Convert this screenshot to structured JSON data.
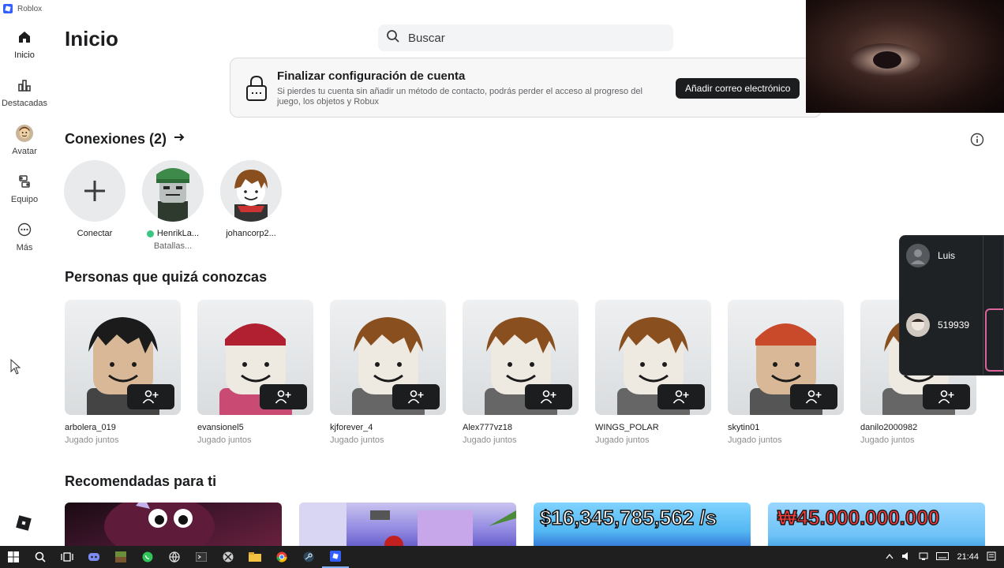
{
  "window": {
    "title": "Roblox"
  },
  "sidebar": {
    "items": [
      {
        "label": "Inicio",
        "icon": "home-icon"
      },
      {
        "label": "Destacadas",
        "icon": "charts-icon"
      },
      {
        "label": "Avatar",
        "icon": "avatar-icon"
      },
      {
        "label": "Equipo",
        "icon": "party-icon"
      },
      {
        "label": "Más",
        "icon": "more-icon"
      }
    ]
  },
  "header": {
    "title": "Inicio",
    "search_placeholder": "Buscar"
  },
  "banner": {
    "title": "Finalizar configuración de cuenta",
    "description": "Si pierdes tu cuenta sin añadir un método de contacto, podrás perder el acceso al progreso del juego, los objetos y Robux",
    "button": "Añadir correo electrónico"
  },
  "connections": {
    "title": "Conexiones (2)",
    "items": [
      {
        "name": "Conectar",
        "sub": ""
      },
      {
        "name": "HenrikLa...",
        "sub": "Batallas...",
        "online": true
      },
      {
        "name": "johancorp2...",
        "sub": ""
      }
    ]
  },
  "people": {
    "title": "Personas que quizá conozcas",
    "items": [
      {
        "name": "arbolera_019",
        "sub": "Jugado juntos"
      },
      {
        "name": "evansionel5",
        "sub": "Jugado juntos"
      },
      {
        "name": "kjforever_4",
        "sub": "Jugado juntos"
      },
      {
        "name": "Alex777vz18",
        "sub": "Jugado juntos"
      },
      {
        "name": "WINGS_POLAR",
        "sub": "Jugado juntos"
      },
      {
        "name": "skytin01",
        "sub": "Jugado juntos"
      },
      {
        "name": "danilo2000982",
        "sub": "Jugado juntos"
      }
    ]
  },
  "recommended": {
    "title": "Recomendadas para ti",
    "banners": [
      "$16,345,785,562 /s",
      "₩45.000.000.000"
    ]
  },
  "friends_popup": {
    "items": [
      {
        "name": "Luis"
      },
      {
        "name": "519939"
      }
    ]
  },
  "taskbar": {
    "time": "21:44"
  },
  "colors": {
    "accent_dark": "#1b1d1f",
    "online": "#39c582",
    "brand": "#335fff"
  }
}
